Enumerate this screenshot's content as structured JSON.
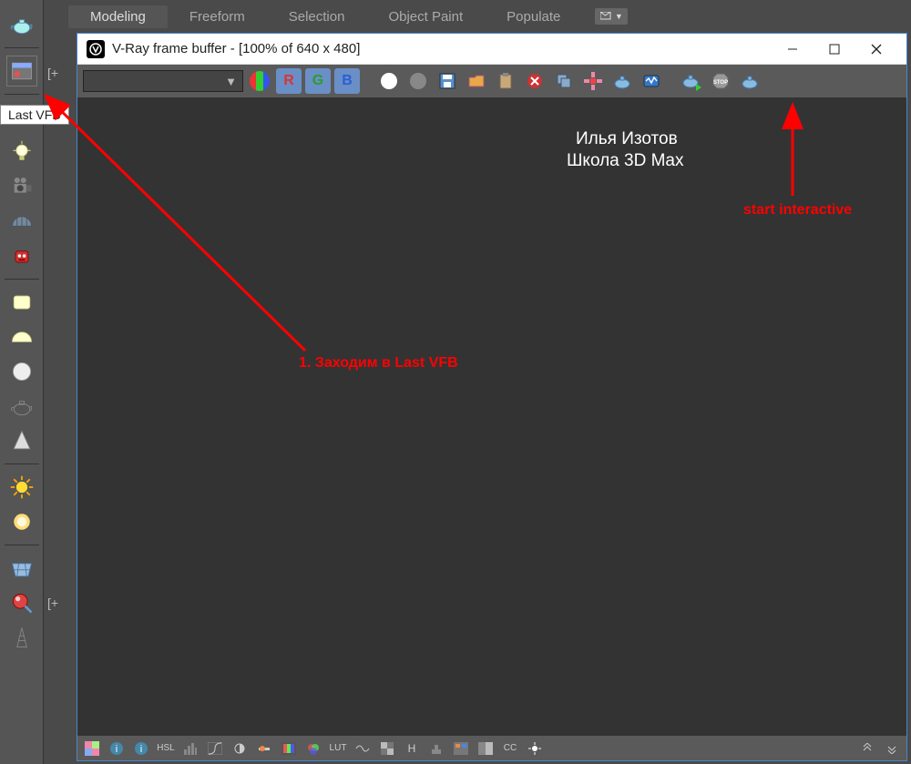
{
  "top_tabs": {
    "items": [
      "Modeling",
      "Freeform",
      "Selection",
      "Object Paint",
      "Populate"
    ],
    "active": 0
  },
  "tooltip": "Last VFB",
  "second_col": {
    "label1": "[+",
    "label2": "[+"
  },
  "vfb": {
    "title": "V-Ray frame buffer - [100% of 640 x 480]",
    "channels": {
      "R": "R",
      "G": "G",
      "B": "B"
    }
  },
  "bottom": {
    "hsl": "HSL",
    "lut": "LUT",
    "h": "H",
    "cc": "CC"
  },
  "annotations": {
    "author1": "Илья Изотов",
    "author2": "Школа 3D Max",
    "start": "start interactive",
    "step1": "1. Заходим в Last VFB"
  }
}
